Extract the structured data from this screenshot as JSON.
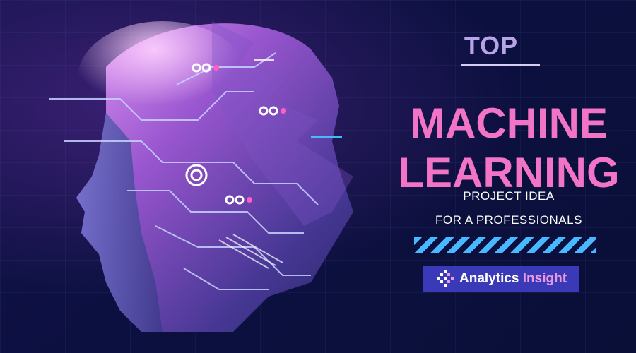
{
  "banner": {
    "eyebrow": "TOP",
    "headline_line1": "MACHINE",
    "headline_line2": "LEARNING",
    "subtitle_line1": "PROJECT IDEA",
    "subtitle_line2": "FOR A PROFESSIONALS",
    "brand_primary": "Analytics",
    "brand_secondary": "Insight"
  },
  "colors": {
    "background": "#0b0f3a",
    "headline": "#f274c6",
    "eyebrow": "#b7a3e8",
    "stripe": "#49b8ff",
    "brand_box": "#3a39b8"
  },
  "icons": [
    "ai-head-illustration",
    "circuit-lines",
    "analytics-insight-logo-icon"
  ]
}
